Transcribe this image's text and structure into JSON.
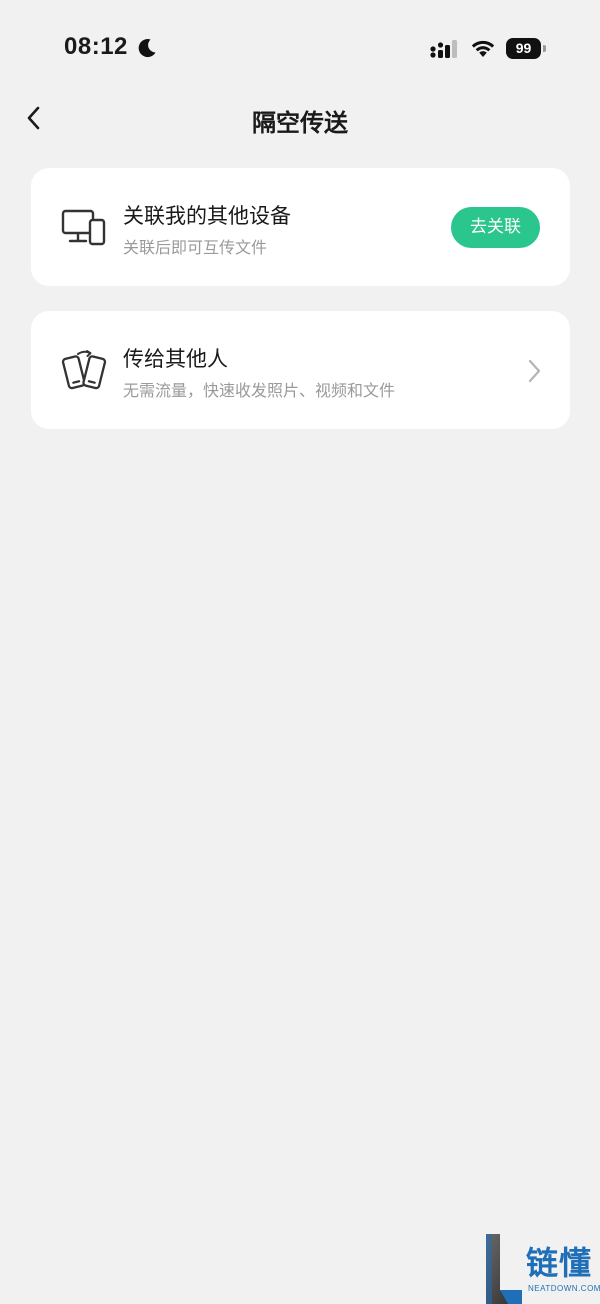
{
  "status_bar": {
    "time": "08:12",
    "battery": "99",
    "icons": [
      "moon-icon",
      "cellular-signal-icon",
      "wifi-icon",
      "battery-icon"
    ]
  },
  "nav": {
    "title": "隔空传送",
    "back_icon": "chevron-left-icon"
  },
  "cards": [
    {
      "icon": "monitor-phone-icon",
      "title": "关联我的其他设备",
      "subtitle": "关联后即可互传文件",
      "action_label": "去关联"
    },
    {
      "icon": "phones-transfer-icon",
      "title": "传给其他人",
      "subtitle": "无需流量，快速收发照片、视频和文件",
      "action_icon": "chevron-right-icon"
    }
  ],
  "watermark": {
    "text": "链懂",
    "sub": "NEATDOWN.COM"
  },
  "colors": {
    "background": "#f1f1f1",
    "card": "#ffffff",
    "accent": "#2ac68e",
    "subtitle": "#9a9a9a"
  }
}
